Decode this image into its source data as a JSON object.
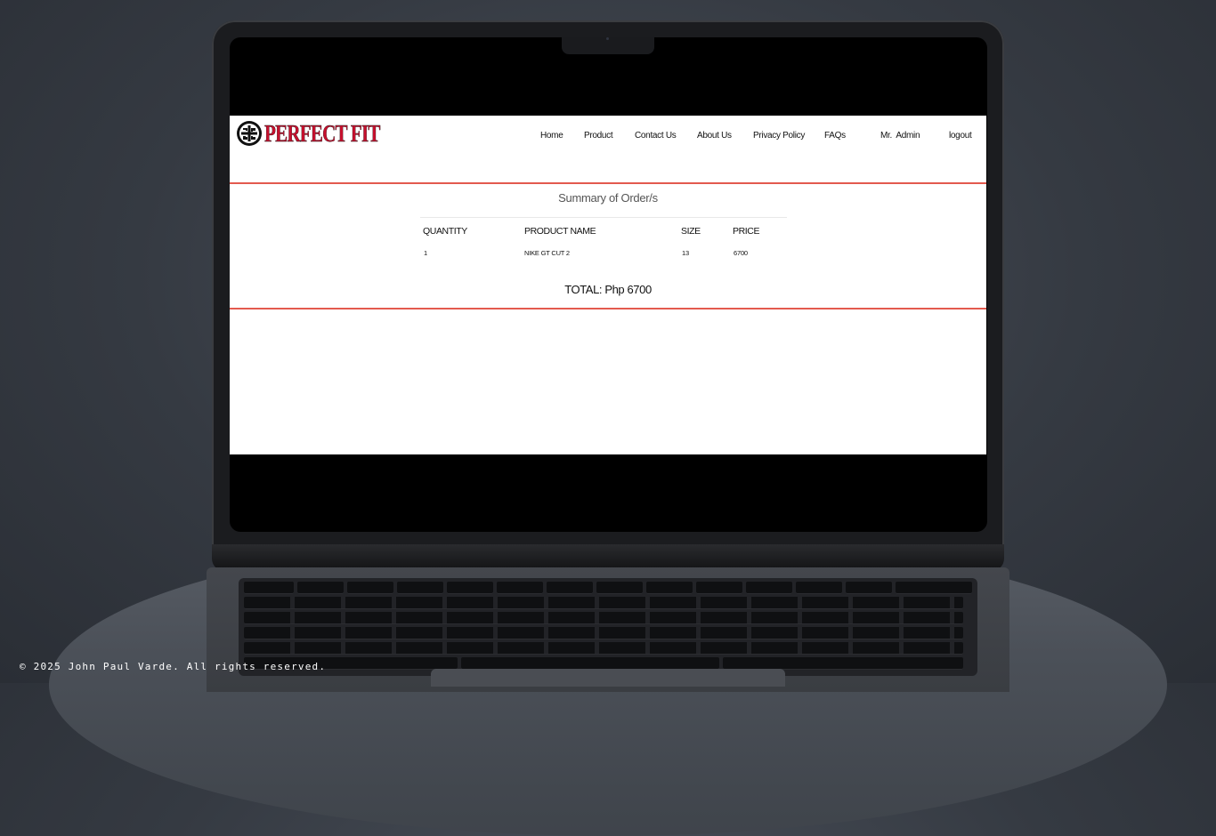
{
  "site": {
    "logo_text": "PERFECT FIT",
    "brand_color": "#c8102e",
    "nav": [
      "Home",
      "Product",
      "Contact Us",
      "About Us",
      "Privacy Policy",
      "FAQs"
    ],
    "user_label": "Mr.  Admin",
    "logout_label": "logout"
  },
  "summary": {
    "title": "Summary of Order/s",
    "columns": [
      "QUANTITY",
      "PRODUCT NAME",
      "SIZE",
      "PRICE"
    ],
    "rows": [
      {
        "quantity": "1",
        "product_name": "NIKE GT CUT 2",
        "size": "13",
        "price": "6700"
      }
    ],
    "total": "TOTAL: Php 6700"
  },
  "footer": {
    "copyright": "© 2025 John Paul Varde. All rights reserved."
  },
  "colors": {
    "accent_rule": "#e35a4e",
    "background": "#353a42"
  }
}
